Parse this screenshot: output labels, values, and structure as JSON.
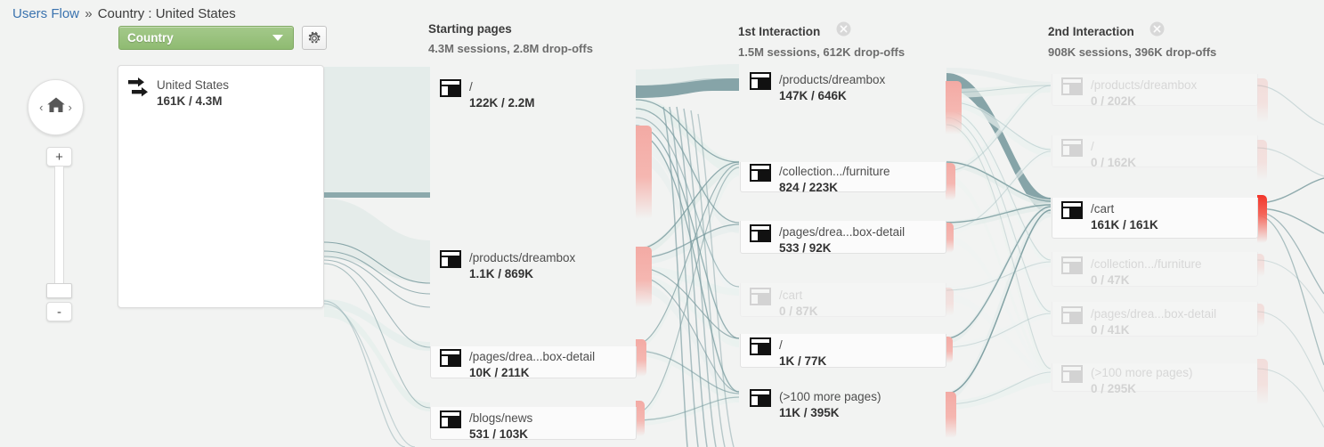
{
  "breadcrumb": {
    "link": "Users Flow",
    "separator": "»",
    "current": "Country : United States"
  },
  "toolbar": {
    "dimension_selected": "Country",
    "gear_icon": "gear-icon",
    "caret_icon": "chevron-down-icon"
  },
  "zoom_control": {
    "home_icon": "home-icon",
    "prev_icon": "chevron-left-icon",
    "next_icon": "chevron-right-icon",
    "zoom_in_label": "+",
    "zoom_out_label": "-"
  },
  "source_panel": {
    "node": {
      "icon": "double-arrow-icon",
      "name": "United States",
      "value": "161K / 4.3M"
    }
  },
  "columns": [
    {
      "id": "starting-pages",
      "title": "Starting pages",
      "subtitle": "4.3M sessions, 2.8M drop-offs",
      "closable": false
    },
    {
      "id": "1st-interaction",
      "title": "1st Interaction",
      "subtitle": "1.5M sessions, 612K drop-offs",
      "closable": true,
      "close_icon": "close-icon"
    },
    {
      "id": "2nd-interaction",
      "title": "2nd Interaction",
      "subtitle": "908K sessions, 396K drop-offs",
      "closable": true,
      "close_icon": "close-icon"
    }
  ],
  "nodes": {
    "starting_pages": [
      {
        "name": "/",
        "value": "122K / 2.2M",
        "icon": "page-icon",
        "dimmed": false
      },
      {
        "name": "/products/dreambox",
        "value": "1.1K / 869K",
        "icon": "page-icon",
        "dimmed": false
      },
      {
        "name": "/pages/drea...box-detail",
        "value": "10K / 211K",
        "icon": "page-icon",
        "dimmed": false
      },
      {
        "name": "/blogs/news",
        "value": "531 / 103K",
        "icon": "page-icon",
        "dimmed": false
      }
    ],
    "first_interaction": [
      {
        "name": "/products/dreambox",
        "value": "147K / 646K",
        "icon": "page-icon",
        "dimmed": false
      },
      {
        "name": "/collection.../furniture",
        "value": "824 / 223K",
        "icon": "page-icon",
        "dimmed": false
      },
      {
        "name": "/pages/drea...box-detail",
        "value": "533 / 92K",
        "icon": "page-icon",
        "dimmed": false
      },
      {
        "name": "/cart",
        "value": "0 / 87K",
        "icon": "page-icon",
        "dimmed": true
      },
      {
        "name": "/",
        "value": "1K / 77K",
        "icon": "page-icon",
        "dimmed": false
      },
      {
        "name": "(>100 more pages)",
        "value": "11K / 395K",
        "icon": "page-icon",
        "dimmed": false
      }
    ],
    "second_interaction": [
      {
        "name": "/products/dreambox",
        "value": "0 / 202K",
        "icon": "page-icon",
        "dimmed": true
      },
      {
        "name": "/",
        "value": "0 / 162K",
        "icon": "page-icon",
        "dimmed": true
      },
      {
        "name": "/cart",
        "value": "161K / 161K",
        "icon": "page-icon",
        "dimmed": false
      },
      {
        "name": "/collection.../furniture",
        "value": "0 / 47K",
        "icon": "page-icon",
        "dimmed": true
      },
      {
        "name": "/pages/drea...box-detail",
        "value": "0 / 41K",
        "icon": "page-icon",
        "dimmed": true
      },
      {
        "name": "(>100 more pages)",
        "value": "0 / 295K",
        "icon": "page-icon",
        "dimmed": true
      }
    ]
  },
  "colors": {
    "node_green_light": "#c9e4b4",
    "node_green_dark": "#76bf51",
    "dropoff_pink": "#f5b7b1",
    "dropoff_red": "#f2352a",
    "flow_teal": "#6f9397",
    "accent_link": "#3b73af",
    "select_green": "#8fbb72",
    "background": "#f2f3f2"
  }
}
